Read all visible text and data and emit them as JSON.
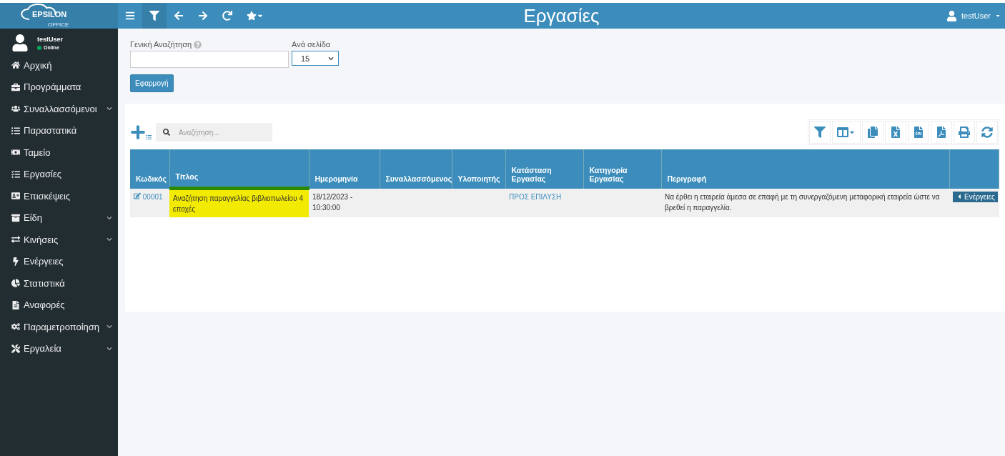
{
  "brand": {
    "logo_text": "EPSILON",
    "logo_subtext": "OFFICE"
  },
  "topbar": {
    "title": "Εργασίες",
    "user": "testUser",
    "tools": [
      {
        "kind": "menu",
        "active": false
      },
      {
        "kind": "filter",
        "active": true
      },
      {
        "kind": "back",
        "active": false
      },
      {
        "kind": "forward",
        "active": false
      },
      {
        "kind": "reload",
        "active": false
      },
      {
        "kind": "favorites",
        "active": false
      }
    ]
  },
  "sidebar": {
    "user": {
      "name": "testUser",
      "status": "Online"
    },
    "items": [
      {
        "label": "Αρχική",
        "has_submenu": false
      },
      {
        "label": "Προγράμματα",
        "has_submenu": false
      },
      {
        "label": "Συναλλασσόμενοι",
        "has_submenu": true
      },
      {
        "label": "Παραστατικά",
        "has_submenu": false
      },
      {
        "label": "Ταμείο",
        "has_submenu": false
      },
      {
        "label": "Εργασίες",
        "has_submenu": false
      },
      {
        "label": "Επισκέψεις",
        "has_submenu": false
      },
      {
        "label": "Είδη",
        "has_submenu": true
      },
      {
        "label": "Κινήσεις",
        "has_submenu": true
      },
      {
        "label": "Ενέργειες",
        "has_submenu": false
      },
      {
        "label": "Στατιστικά",
        "has_submenu": false
      },
      {
        "label": "Αναφορές",
        "has_submenu": false
      },
      {
        "label": "Παραμετροποίηση",
        "has_submenu": true
      },
      {
        "label": "Εργαλεία",
        "has_submenu": true
      }
    ]
  },
  "filters": {
    "search_label": "Γενική Αναζήτηση",
    "per_page_label": "Ανά σελίδα",
    "per_page_value": "15",
    "apply_button": "Εφαρμογή"
  },
  "table_toolbar": {
    "search_placeholder": "Αναζήτηση...",
    "buttons": [
      {
        "kind": "filter"
      },
      {
        "kind": "columns"
      },
      {
        "kind": "copy"
      },
      {
        "kind": "excel"
      },
      {
        "kind": "csv"
      },
      {
        "kind": "pdf"
      },
      {
        "kind": "print"
      },
      {
        "kind": "refresh"
      }
    ]
  },
  "table": {
    "columns": [
      "Κωδικός",
      "Τίτλος",
      "Ημερομηνία",
      "Συναλλασσόμενος",
      "Υλοποιητής",
      "Κατάσταση Εργασίας",
      "Κατηγορία Εργασίας",
      "Περιγραφή"
    ],
    "rows": [
      {
        "code": "00001",
        "title": "Αναζήτηση παραγγελίας βιβλιοπωλείου 4 εποχές",
        "title_highlighted": true,
        "date": "18/12/2023 - 10:30:00",
        "status": "ΠΡΟΣ ΕΠΙΛΥΣΗ",
        "description": "Να έρθει η εταιρεία άμεσα σε επαφή με τη συνεργαζόμενη μεταφορική εταιρεία ώστε να βρεθεί η παραγγελία.",
        "action": "Ενέργειες"
      }
    ]
  }
}
